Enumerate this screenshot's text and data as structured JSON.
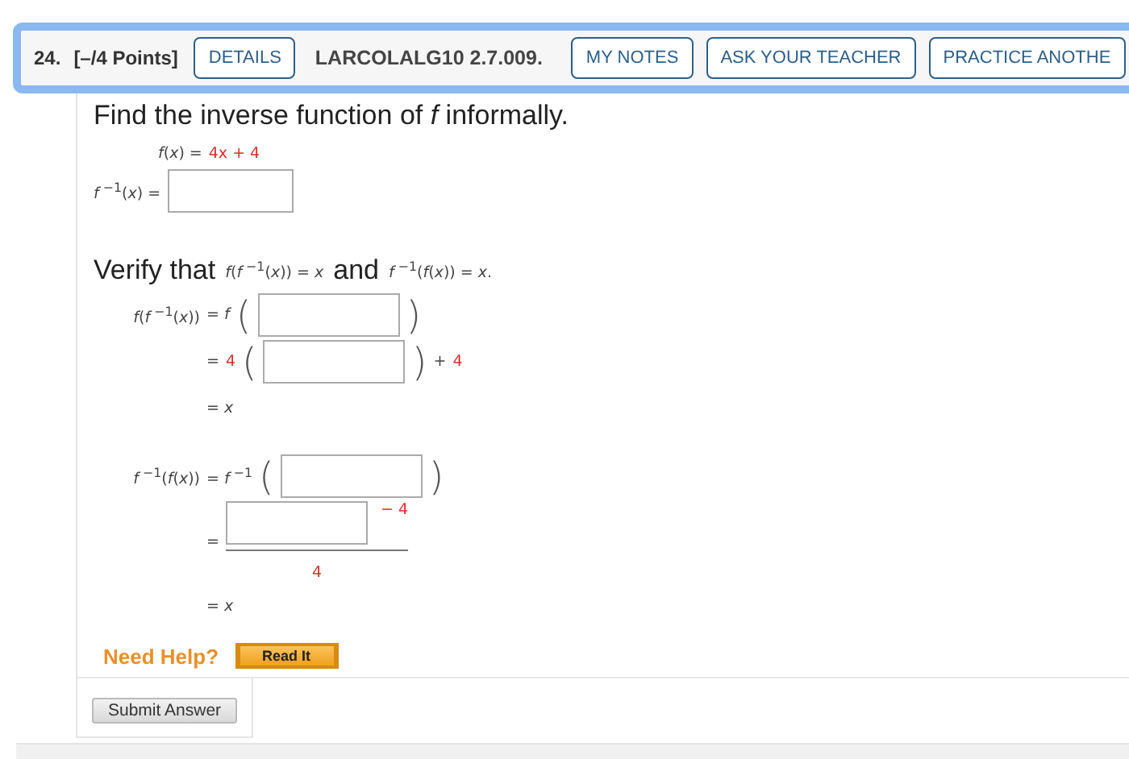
{
  "header": {
    "number": "24.",
    "points": "[–/4 Points]",
    "buttons": [
      {
        "label": "DETAILS"
      },
      {
        "kind": "code",
        "label": "LARCOLALG10 2.7.009."
      },
      {
        "label": "MY NOTES"
      },
      {
        "label": "ASK YOUR TEACHER"
      },
      {
        "label": "PRACTICE ANOTHE"
      }
    ]
  },
  "question": "Find the inverse function of *f* informally.",
  "given": {
    "lhs": "*f*(*x*) =",
    "rhs": "4x + 4"
  },
  "answer": {
    "lhs": "*f*$^{ −1}$(*x*) ="
  },
  "verify": [
    {
      "kind": "prose",
      "text": "Verify that"
    },
    {
      "kind": "math",
      "text": "*f*(*f*$^{ −1}$(*x*)) = *x*"
    },
    {
      "kind": "prose",
      "text": "and"
    },
    {
      "kind": "math",
      "text": "*f*$^{ −1}$(*f*(*x*)) = *x*."
    }
  ],
  "equations": [
    {
      "lines": [
        {
          "lhs": "*f*(*f*$^{ −1}$(*x*))",
          "tokens": [
            {
              "kind": "math",
              "text": "= *f*"
            },
            {
              "kind": "paren",
              "text": "("
            },
            {
              "kind": "field"
            },
            {
              "kind": "paren",
              "text": ")"
            }
          ]
        },
        {
          "tokens": [
            {
              "kind": "math",
              "text": "="
            },
            {
              "kind": "given",
              "text": "4"
            },
            {
              "kind": "paren",
              "text": "("
            },
            {
              "kind": "field"
            },
            {
              "kind": "paren",
              "text": ")"
            },
            {
              "kind": "math",
              "text": "+"
            },
            {
              "kind": "given",
              "text": "4"
            }
          ]
        },
        {
          "tokens": [
            {
              "kind": "math",
              "text": "= *x*"
            }
          ]
        }
      ]
    },
    {
      "lines": [
        {
          "lhs": "*f*$^{ −1}$(*f*(*x*))",
          "tokens": [
            {
              "kind": "math",
              "text": "= *f*$^{ −1}$"
            },
            {
              "kind": "paren",
              "text": "("
            },
            {
              "kind": "field"
            },
            {
              "kind": "paren",
              "text": ")"
            }
          ]
        },
        {
          "tokens": [
            {
              "kind": "math",
              "text": "="
            },
            {
              "kind": "fraction",
              "numerator": [
                {
                  "kind": "field"
                },
                {
                  "kind": "given",
                  "text": "− 4"
                }
              ],
              "denominator": "4"
            }
          ]
        },
        {
          "tokens": [
            {
              "kind": "math",
              "text": "= *x*"
            }
          ]
        }
      ]
    }
  ],
  "help": {
    "label": "Need Help?",
    "button": "Read It"
  },
  "submit": "Submit Answer"
}
